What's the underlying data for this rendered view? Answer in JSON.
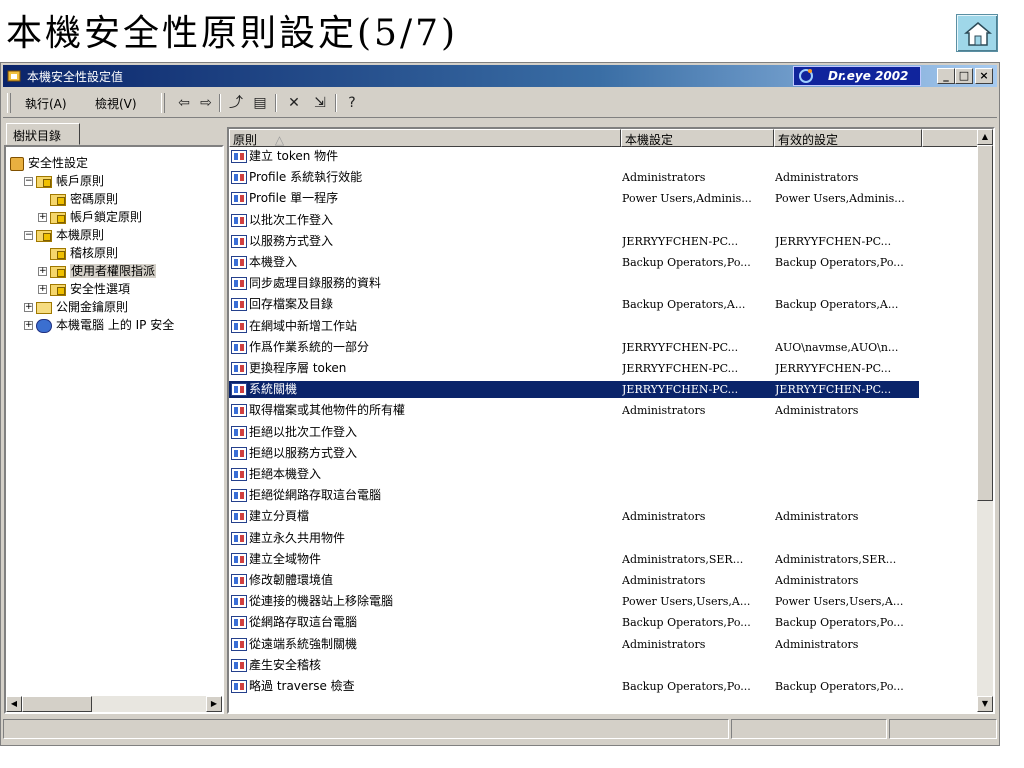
{
  "slide": {
    "title": "本機安全性原則設定(5/7)"
  },
  "window": {
    "title": "本機安全性設定值",
    "dreye_label": "Dr.eye 2002",
    "caption": {
      "minimize": "_",
      "maximize": "□",
      "close": "×"
    }
  },
  "menu": {
    "action": "執行(A)",
    "view": "檢視(V)"
  },
  "toolbar": {
    "icons": [
      "back-arrow-icon",
      "forward-arrow-icon",
      "up-folder-icon",
      "show-hide-tree-icon",
      "delete-icon",
      "export-list-icon",
      "help-icon"
    ],
    "glyphs": {
      "back": "⇦",
      "forward": "⇨",
      "up": "⤴",
      "tree": "▤",
      "delete": "✕",
      "export": "⇲",
      "help": "?"
    }
  },
  "tree": {
    "tab_label": "樹狀目錄",
    "nodes": [
      {
        "label": "安全性設定",
        "level": 0,
        "icon": "shield-icon",
        "expander": ""
      },
      {
        "label": "帳戶原則",
        "level": 1,
        "icon": "folder-icon",
        "expander": "−"
      },
      {
        "label": "密碼原則",
        "level": 2,
        "icon": "folder-icon",
        "expander": ""
      },
      {
        "label": "帳戶鎖定原則",
        "level": 2,
        "icon": "folder-icon",
        "expander": "+"
      },
      {
        "label": "本機原則",
        "level": 1,
        "icon": "folder-icon",
        "expander": "−"
      },
      {
        "label": "稽核原則",
        "level": 2,
        "icon": "folder-icon",
        "expander": ""
      },
      {
        "label": "使用者權限指派",
        "level": 2,
        "icon": "folder-icon",
        "expander": "+",
        "selected": true
      },
      {
        "label": "安全性選項",
        "level": 2,
        "icon": "folder-icon",
        "expander": "+"
      },
      {
        "label": "公開金鑰原則",
        "level": 1,
        "icon": "plain-folder-icon",
        "expander": "+"
      },
      {
        "label": "本機電腦 上的 IP 安全",
        "level": 1,
        "icon": "network-icon",
        "expander": "+"
      }
    ]
  },
  "list": {
    "columns": {
      "policy": "原則",
      "sort_indicator": "△",
      "local": "本機設定",
      "effective": "有效的設定"
    },
    "rows": [
      {
        "policy": "建立 token 物件",
        "local": "",
        "effective": ""
      },
      {
        "policy": "Profile 系統執行效能",
        "local": "Administrators",
        "effective": "Administrators"
      },
      {
        "policy": "Profile 單一程序",
        "local": "Power Users,Adminis...",
        "effective": "Power Users,Adminis..."
      },
      {
        "policy": "以批次工作登入",
        "local": "",
        "effective": ""
      },
      {
        "policy": "以服務方式登入",
        "local": "JERRYYFCHEN-PC...",
        "effective": "JERRYYFCHEN-PC..."
      },
      {
        "policy": "本機登入",
        "local": "Backup Operators,Po...",
        "effective": "Backup Operators,Po..."
      },
      {
        "policy": "同步處理目錄服務的資料",
        "local": "",
        "effective": ""
      },
      {
        "policy": "回存檔案及目錄",
        "local": "Backup Operators,A...",
        "effective": "Backup Operators,A..."
      },
      {
        "policy": "在網域中新增工作站",
        "local": "",
        "effective": ""
      },
      {
        "policy": "作爲作業系統的一部分",
        "local": "JERRYYFCHEN-PC...",
        "effective": "AUO\\navmse,AUO\\n..."
      },
      {
        "policy": "更換程序層 token",
        "local": "JERRYYFCHEN-PC...",
        "effective": "JERRYYFCHEN-PC..."
      },
      {
        "policy": "系統關機",
        "local": "JERRYYFCHEN-PC...",
        "effective": "JERRYYFCHEN-PC...",
        "selected": true
      },
      {
        "policy": "取得檔案或其他物件的所有權",
        "local": "Administrators",
        "effective": "Administrators"
      },
      {
        "policy": "拒絕以批次工作登入",
        "local": "",
        "effective": ""
      },
      {
        "policy": "拒絕以服務方式登入",
        "local": "",
        "effective": ""
      },
      {
        "policy": "拒絕本機登入",
        "local": "",
        "effective": ""
      },
      {
        "policy": "拒絕從網路存取這台電腦",
        "local": "",
        "effective": ""
      },
      {
        "policy": "建立分頁檔",
        "local": "Administrators",
        "effective": "Administrators"
      },
      {
        "policy": "建立永久共用物件",
        "local": "",
        "effective": ""
      },
      {
        "policy": "建立全域物件",
        "local": "Administrators,SER...",
        "effective": "Administrators,SER..."
      },
      {
        "policy": "修改韌體環境值",
        "local": "Administrators",
        "effective": "Administrators"
      },
      {
        "policy": "從連接的機器站上移除電腦",
        "local": "Power Users,Users,A...",
        "effective": "Power Users,Users,A..."
      },
      {
        "policy": "從網路存取這台電腦",
        "local": "Backup Operators,Po...",
        "effective": "Backup Operators,Po..."
      },
      {
        "policy": "從遠端系統強制關機",
        "local": "Administrators",
        "effective": "Administrators"
      },
      {
        "policy": "產生安全稽核",
        "local": "",
        "effective": ""
      },
      {
        "policy": "略過 traverse 檢查",
        "local": "Backup Operators,Po...",
        "effective": "Backup Operators,Po..."
      }
    ]
  },
  "scroll": {
    "up": "▲",
    "down": "▼",
    "left": "◀",
    "right": "▶"
  }
}
